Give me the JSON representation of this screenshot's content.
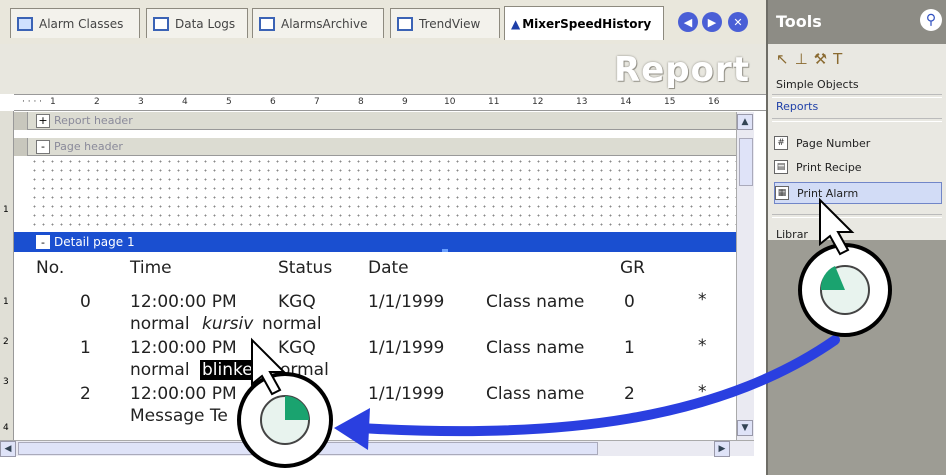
{
  "tabs": [
    {
      "label": "Alarm Classes",
      "icon": "alarm-classes-icon"
    },
    {
      "label": "Data Logs",
      "icon": "data-logs-icon"
    },
    {
      "label": "AlarmsArchive",
      "icon": "window-icon"
    },
    {
      "label": "TrendView",
      "icon": "window-icon"
    },
    {
      "label": "MixerSpeedHistory",
      "icon": "report-icon"
    }
  ],
  "nav": {
    "prev": "◀",
    "next": "▶",
    "close": "✕"
  },
  "report": {
    "title": "Report",
    "ruler_ticks": [
      "1",
      "2",
      "3",
      "4",
      "5",
      "6",
      "7",
      "8",
      "9",
      "10",
      "11",
      "12",
      "13",
      "14",
      "15",
      "16"
    ],
    "sections": {
      "report_header": {
        "toggle": "+",
        "label": "Report header"
      },
      "page_header": {
        "toggle": "-",
        "label": "Page header"
      },
      "detail": {
        "toggle": "-",
        "label": "Detail page 1"
      }
    },
    "left_numbers": [
      "1",
      "1",
      "2",
      "3",
      "4"
    ],
    "columns": [
      "No.",
      "Time",
      "Status",
      "Date",
      "GR"
    ],
    "rows": [
      {
        "no": "0",
        "time": "12:00:00 PM",
        "status": "KGQ",
        "date": "1/1/1999",
        "class": "Class name",
        "gr": "0",
        "star": "*"
      },
      {
        "no": "1",
        "time": "12:00:00 PM",
        "status": "KGQ",
        "date": "1/1/1999",
        "class": "Class name",
        "gr": "1",
        "star": "*"
      },
      {
        "no": "2",
        "time": "12:00:00 PM",
        "status": "",
        "date": "1/1/1999",
        "class": "Class name",
        "gr": "2",
        "star": "*"
      }
    ],
    "subtext": {
      "r1_a": "normal",
      "r1_b": "kursiv",
      "r1_c": "normal",
      "r2_a": "normal",
      "r2_b": "blinke",
      "r2_c": "ormal",
      "r3_a": "Message Te"
    }
  },
  "tools": {
    "title": "Tools",
    "categories": {
      "simple": "Simple Objects",
      "reports": "Reports",
      "libraries": "Librar"
    },
    "items": [
      {
        "label": "Page Number",
        "icon": "#"
      },
      {
        "label": "Print Recipe",
        "icon": "▤"
      },
      {
        "label": "Print Alarm",
        "icon": "▦"
      }
    ]
  },
  "colors": {
    "accent": "#1a4fd0",
    "arrow": "#2a3fe0"
  }
}
